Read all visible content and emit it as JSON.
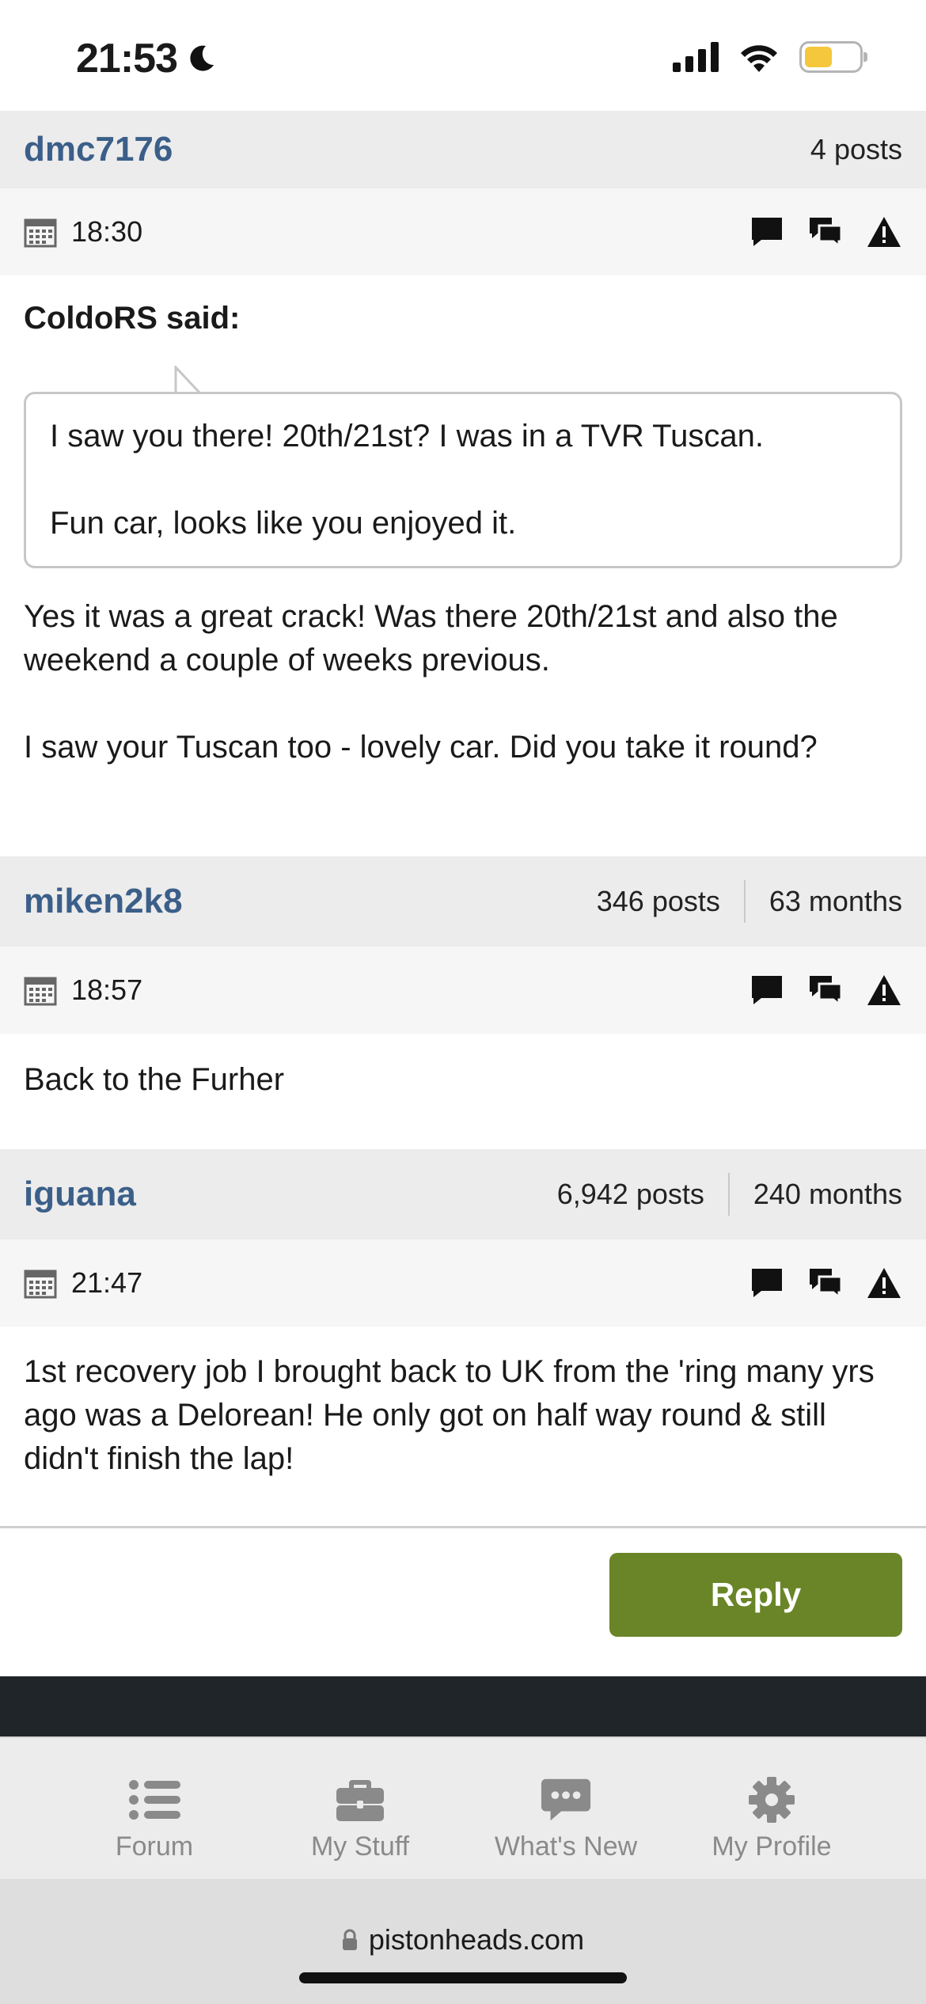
{
  "status_bar": {
    "time": "21:53"
  },
  "posts": [
    {
      "username": "dmc7176",
      "stats": [
        "4 posts"
      ],
      "time": "18:30",
      "quote_author": "ColdoRS said:",
      "quote_lines": [
        "I saw you there! 20th/21st? I was in a TVR Tuscan.",
        "Fun car, looks like you enjoyed it."
      ],
      "body_lines": [
        "Yes it was a great crack! Was there 20th/21st and also the weekend a couple of weeks previous.",
        "I saw your Tuscan too - lovely car. Did you take it round?"
      ]
    },
    {
      "username": "miken2k8",
      "stats": [
        "346 posts",
        "63 months"
      ],
      "time": "18:57",
      "body_lines": [
        "Back to the Furher"
      ]
    },
    {
      "username": "iguana",
      "stats": [
        "6,942 posts",
        "240 months"
      ],
      "time": "21:47",
      "body_lines": [
        "1st recovery job I brought back to UK from the 'ring many yrs ago was a Delorean! He only got on half way round & still didn't finish the lap!"
      ]
    }
  ],
  "reply_label": "Reply",
  "tabs": [
    {
      "label": "Forum",
      "icon": "list-icon"
    },
    {
      "label": "My Stuff",
      "icon": "briefcase-icon"
    },
    {
      "label": "What's New",
      "icon": "chat-bubble-icon"
    },
    {
      "label": "My Profile",
      "icon": "gear-icon"
    }
  ],
  "url": "pistonheads.com",
  "colors": {
    "username": "#3b5f89",
    "reply_button": "#6a8528",
    "battery": "#f4c73d"
  }
}
